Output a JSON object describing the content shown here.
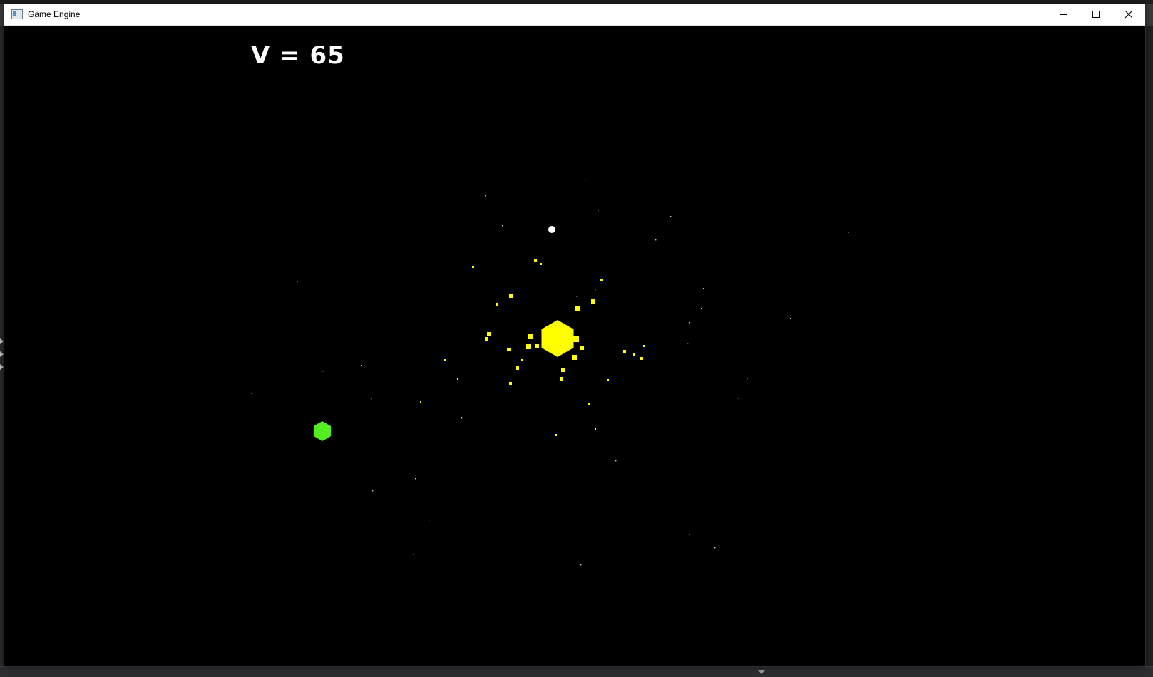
{
  "window": {
    "title": "Game Engine",
    "icon": "app-window-icon",
    "controls": [
      "minimize-icon",
      "maximize-icon",
      "close-icon"
    ]
  },
  "hud": {
    "velocity_text": "V = 65"
  },
  "scene": {
    "background_color": "#000000",
    "star_color": "#cccccc",
    "sun_color": "#ffff00",
    "debris_color": "#ffff00",
    "player_color": "#55ee22",
    "moon_color": "#ffffff"
  }
}
